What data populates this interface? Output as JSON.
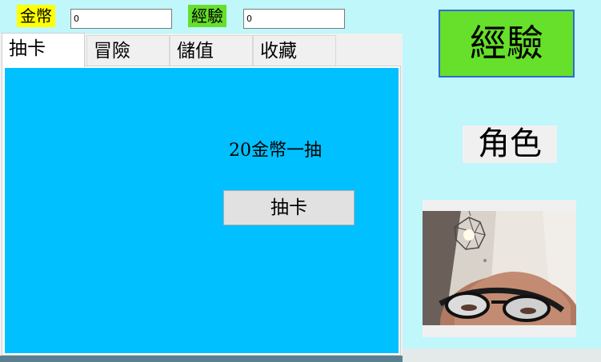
{
  "stats": {
    "coins_label": "金幣",
    "coins_value": "0",
    "exp_label": "經驗",
    "exp_value": "0"
  },
  "tabs": [
    {
      "label": "抽卡",
      "active": true
    },
    {
      "label": "冒險",
      "active": false
    },
    {
      "label": "儲值",
      "active": false
    },
    {
      "label": "收藏",
      "active": false
    }
  ],
  "draw_page": {
    "price_text": "20金幣一抽",
    "draw_button_label": "抽卡"
  },
  "side": {
    "exp_big_label": "經驗",
    "role_label": "角色",
    "portrait_icon": "character-photo"
  },
  "colors": {
    "background": "#bff7fb",
    "coins_highlight": "#ffff00",
    "exp_highlight": "#66e02a",
    "page_background": "#00c0ff",
    "exp_big_border": "#2f6bd6"
  }
}
